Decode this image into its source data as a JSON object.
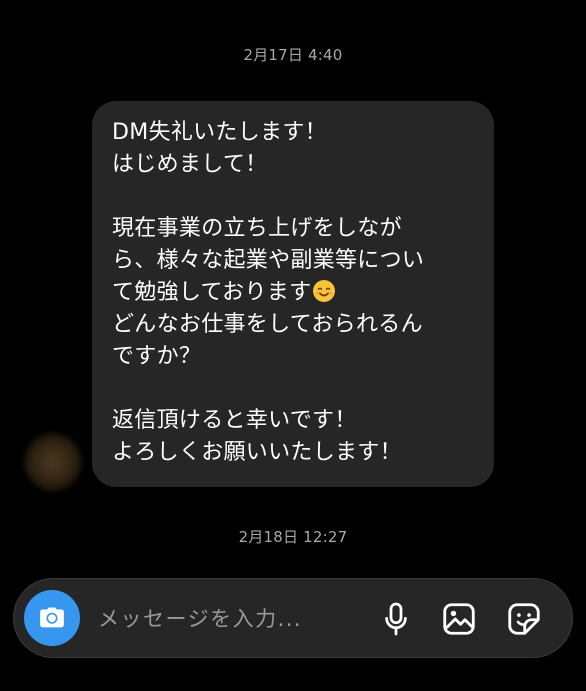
{
  "timestamps": {
    "first": "2月17日 4:40",
    "second": "2月18日 12:27"
  },
  "message": {
    "lines": [
      "DM失礼いたします！",
      "はじめまして！",
      "",
      "現在事業の立ち上げをしなが",
      "ら、様々な起業や副業等につい",
      "て勉強しております",
      "どんなお仕事をしておられるん",
      "ですか？",
      "",
      "返信頂けると幸いです！",
      "よろしくお願いいたします！"
    ],
    "emoji_after_line_6": "smiling-face-emoji"
  },
  "composer": {
    "placeholder": "メッセージを入力...",
    "camera_icon": "camera-icon",
    "mic_icon": "microphone-icon",
    "gallery_icon": "image-icon",
    "sticker_icon": "sticker-icon"
  },
  "colors": {
    "background": "#000000",
    "bubble": "#262626",
    "camera_button": "#3797f0",
    "timestamp_text": "#a8a8a8"
  }
}
